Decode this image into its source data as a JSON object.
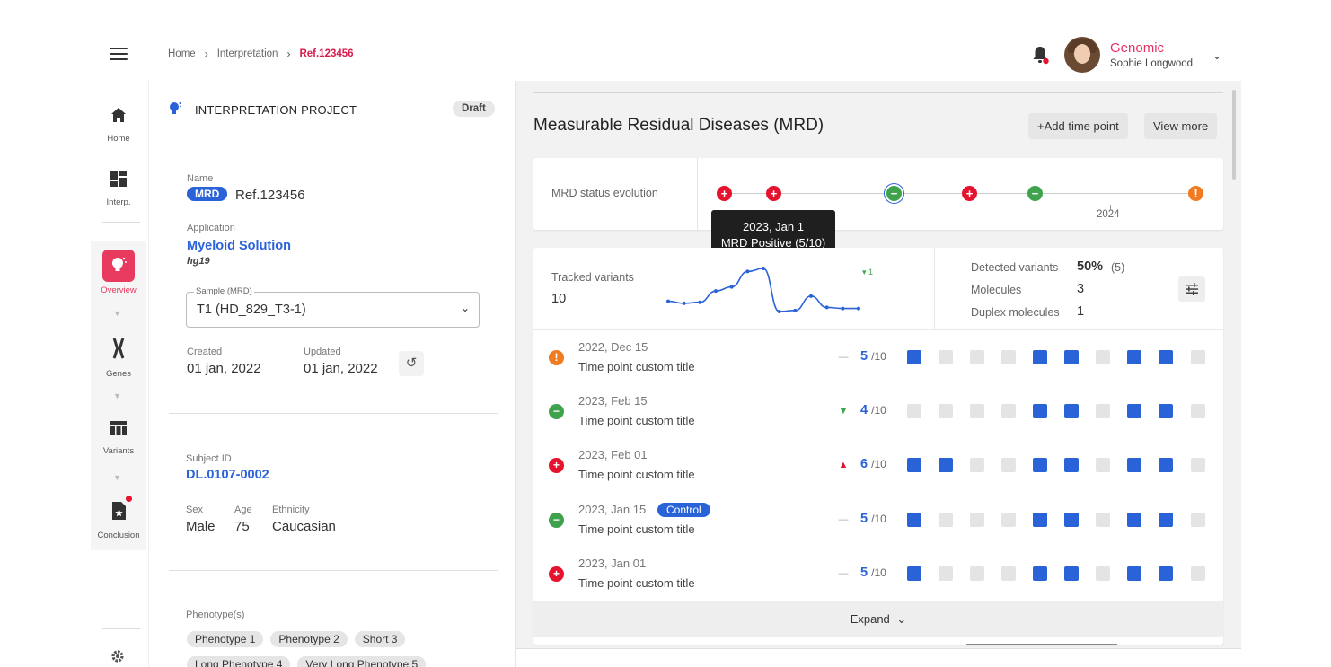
{
  "header": {
    "breadcrumb": [
      "Home",
      "Interpretation",
      "Ref.123456"
    ],
    "user_org": "Genomic",
    "user_name": "Sophie Longwood"
  },
  "rail": {
    "home": "Home",
    "interp": "Interp.",
    "overview": "Overview",
    "genes": "Genes",
    "variants": "Variants",
    "conclusion": "Conclusion"
  },
  "project": {
    "title": "INTERPRETATION PROJECT",
    "status": "Draft",
    "name_label": "Name",
    "name_chip": "MRD",
    "name_value": "Ref.123456",
    "application_label": "Application",
    "application_value": "Myeloid Solution",
    "application_sub": "hg19",
    "sample_legend": "Sample (MRD)",
    "sample_value": "T1 (HD_829_T3-1)",
    "created_label": "Created",
    "created_value": "01 jan, 2022",
    "updated_label": "Updated",
    "updated_value": "01 jan, 2022",
    "subject_label": "Subject ID",
    "subject_value": "DL.0107-0002",
    "sex_label": "Sex",
    "sex_value": "Male",
    "age_label": "Age",
    "age_value": "75",
    "ethnicity_label": "Ethnicity",
    "ethnicity_value": "Caucasian",
    "phenotype_label": "Phenotype(s)",
    "phenotypes_row1": [
      "Phenotype 1",
      "Phenotype 2",
      "Short 3"
    ],
    "phenotypes_row2": [
      "Long Phenotype 4",
      "Very Long Phenotype 5"
    ]
  },
  "main": {
    "title": "Measurable Residual Diseases (MRD)",
    "add_button": "+Add time point",
    "view_more_button": "View more",
    "status_label": "MRD status evolution",
    "timeline_year": "2024",
    "timeline_statuses": [
      "positive",
      "positive",
      "negative",
      "positive",
      "negative",
      "warning"
    ],
    "tooltip_line1": "2023, Jan 1",
    "tooltip_line2": "MRD Positive (5/10)",
    "tracked_label": "Tracked variants",
    "tracked_value": "10",
    "spark_delta": "1",
    "spark_values": [
      6.4,
      6.2,
      6.3,
      7.4,
      7.8,
      9.3,
      9.6,
      5.4,
      5.5,
      6.9,
      5.8,
      5.7,
      5.7
    ],
    "detected_label": "Detected variants",
    "detected_value": "50%",
    "detected_count": "(5)",
    "molecules_label": "Molecules",
    "molecules_value": "3",
    "duplex_label": "Duplex molecules",
    "duplex_value": "1",
    "expand_label": "Expand",
    "timepoints": [
      {
        "date": "2022, Dec 15",
        "title": "Time point custom title",
        "status": "warning",
        "trend": "flat",
        "count": "5",
        "total": "/10",
        "control": "",
        "squares": [
          1,
          0,
          0,
          0,
          1,
          1,
          0,
          1,
          1,
          0
        ]
      },
      {
        "date": "2023, Feb 15",
        "title": "Time point custom title",
        "status": "negative",
        "trend": "down",
        "count": "4",
        "total": "/10",
        "control": "",
        "squares": [
          0,
          0,
          0,
          0,
          1,
          1,
          0,
          1,
          1,
          0
        ]
      },
      {
        "date": "2023, Feb 01",
        "title": "Time point custom title",
        "status": "positive",
        "trend": "up",
        "count": "6",
        "total": "/10",
        "control": "",
        "squares": [
          1,
          1,
          0,
          0,
          1,
          1,
          0,
          1,
          1,
          0
        ]
      },
      {
        "date": "2023, Jan 15",
        "title": "Time point custom title",
        "status": "negative",
        "trend": "flat",
        "count": "5",
        "total": "/10",
        "control": "Control",
        "squares": [
          1,
          0,
          0,
          0,
          1,
          1,
          0,
          1,
          1,
          0
        ]
      },
      {
        "date": "2023, Jan 01",
        "title": "Time point custom title",
        "status": "positive",
        "trend": "flat",
        "count": "5",
        "total": "/10",
        "control": "",
        "squares": [
          1,
          0,
          0,
          0,
          1,
          1,
          0,
          1,
          1,
          0
        ]
      }
    ]
  },
  "colors": {
    "accent": "#2a62d8",
    "brand_pink": "#e83a5f",
    "positive": "#e5132e",
    "negative": "#3fa34d",
    "warning": "#f07b20"
  }
}
